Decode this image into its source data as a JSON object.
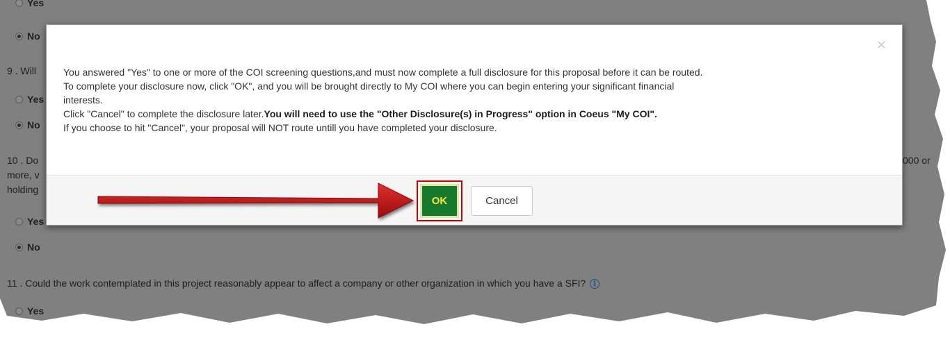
{
  "background_form": {
    "q8": {
      "options": [
        {
          "label": "Yes",
          "checked": false
        },
        {
          "label": "No",
          "checked": true
        }
      ]
    },
    "q9": {
      "prefix": "9 . Will",
      "options": [
        {
          "label": "Yes",
          "checked": false
        },
        {
          "label": "No",
          "checked": true
        }
      ]
    },
    "q10": {
      "line1": "10 . Do",
      "line2": "more, v",
      "line3": "holding",
      "right_fragment": "000 or",
      "options": [
        {
          "label": "Yes",
          "checked": false
        },
        {
          "label": "No",
          "checked": true
        }
      ]
    },
    "q11": {
      "text": "11 . Could the work contemplated in this project reasonably appear to affect a company or other organization in which you have a SFI?",
      "info_icon": "info-icon",
      "info_glyph": "i",
      "options": [
        {
          "label": "Yes",
          "checked": false
        }
      ]
    }
  },
  "modal": {
    "close_glyph": "×",
    "message": {
      "line1": "You answered \"Yes\" to one or more of the COI screening questions,and must now complete a full disclosure for this proposal before it can be routed.",
      "line2": "To complete your disclosure now, click \"OK\", and you will be brought directly to My COI where you can begin entering your significant financial",
      "line3": "interests.",
      "line4_normal": "Click \"Cancel\" to complete the disclosure later.",
      "line4_bold": "You will need to use the \"Other Disclosure(s) in Progress\" option in Coeus \"My COI\".",
      "line5": "If you choose to hit \"Cancel\", your proposal will NOT route untill you have completed your disclosure."
    },
    "ok_label": "OK",
    "cancel_label": "Cancel"
  },
  "colors": {
    "overlay_gray": "#808080",
    "ok_green": "#157a2e",
    "ok_text_yellow": "#ffe23a",
    "annotation_red": "#c00000"
  }
}
